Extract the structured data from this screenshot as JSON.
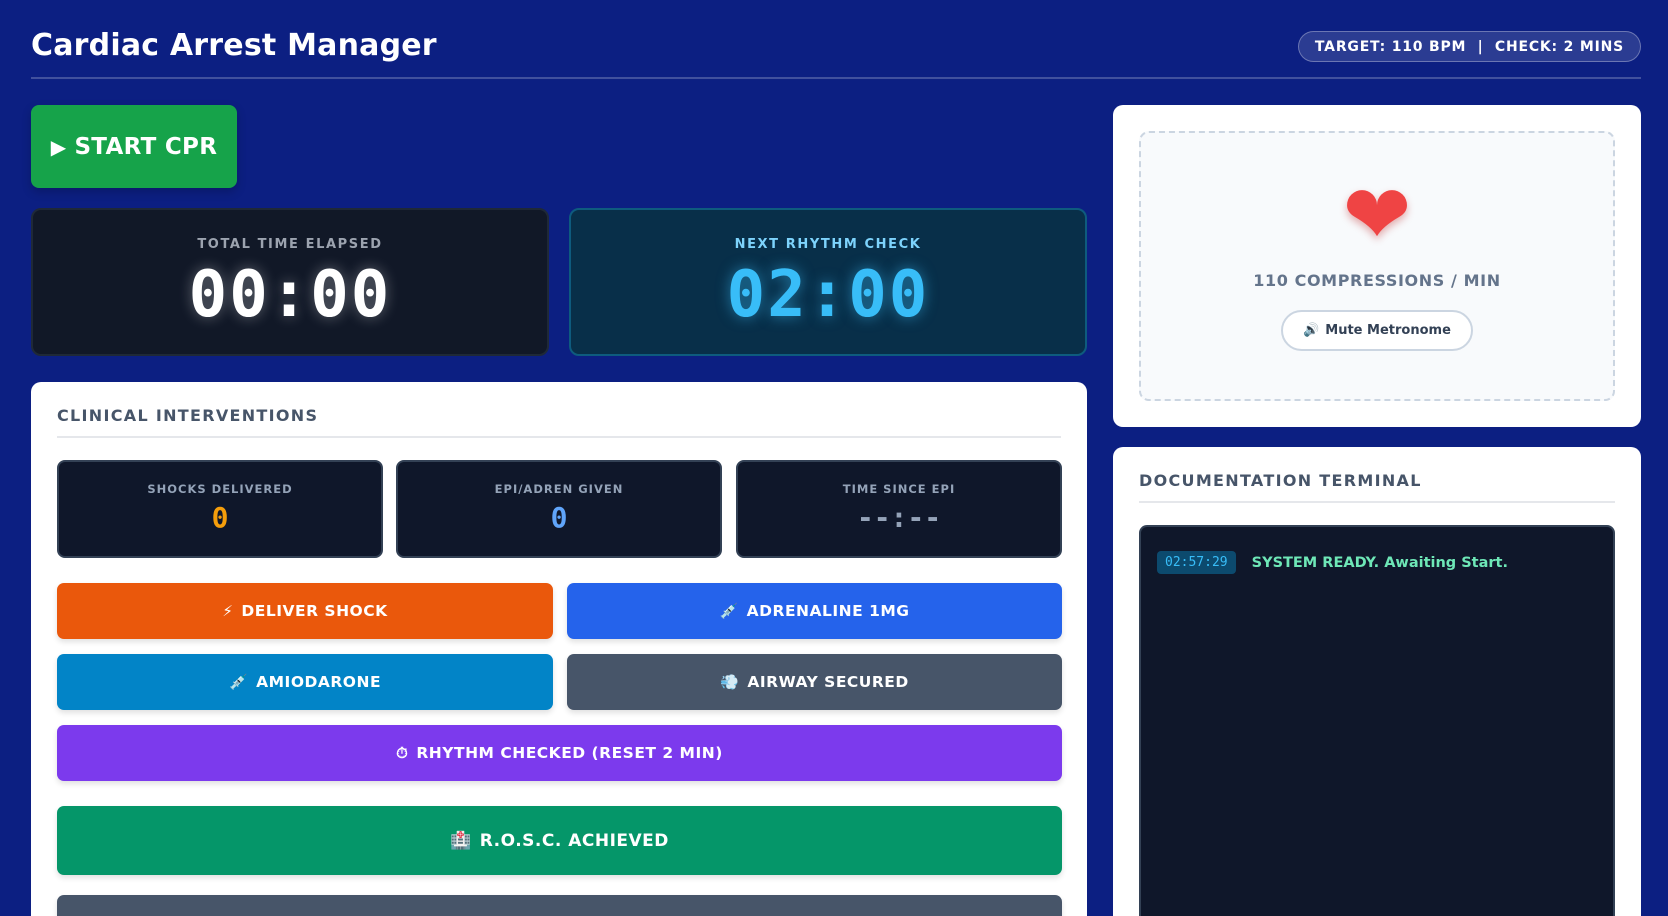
{
  "header": {
    "title": "Cardiac Arrest Manager",
    "target_pill": "TARGET: 110 BPM  |  CHECK: 2 MINS"
  },
  "start_button": {
    "icon": "play-icon",
    "glyph": "▶",
    "label": "START CPR"
  },
  "timers": {
    "total": {
      "label": "TOTAL TIME ELAPSED",
      "value": "00:00"
    },
    "next_check": {
      "label": "NEXT RHYTHM CHECK",
      "value": "02:00"
    }
  },
  "clinical": {
    "heading": "CLINICAL INTERVENTIONS",
    "stats": [
      {
        "label": "SHOCKS DELIVERED",
        "value": "0",
        "color": "#f59e0b"
      },
      {
        "label": "EPI/ADREN GIVEN",
        "value": "0",
        "color": "#60a5fa"
      },
      {
        "label": "TIME SINCE EPI",
        "value": "--:--",
        "color": "#94a3b8"
      }
    ],
    "actions": {
      "shock": {
        "glyph": "⚡",
        "label": "DELIVER SHOCK",
        "color": "#ea580c"
      },
      "adrenaline": {
        "glyph": "💉",
        "label": "ADRENALINE 1MG",
        "color": "#2563eb"
      },
      "amiodarone": {
        "glyph": "💉",
        "label": "AMIODARONE",
        "color": "#0284c7"
      },
      "airway": {
        "glyph": "💨",
        "label": "AIRWAY SECURED",
        "color": "#475569"
      },
      "rhythm": {
        "glyph": "⏱",
        "label": "RHYTHM CHECKED (RESET 2 MIN)",
        "color": "#7c3aed"
      },
      "rosc": {
        "glyph": "🏥",
        "label": "R.O.S.C. ACHIEVED",
        "color": "#059669"
      },
      "next_hidden": {
        "color": "#475569"
      }
    }
  },
  "metronome": {
    "icon": "heart-icon",
    "glyph": "❤",
    "rate_label": "110 COMPRESSIONS / MIN",
    "mute": {
      "glyph": "🔊",
      "label": "Mute Metronome"
    }
  },
  "documentation": {
    "heading": "DOCUMENTATION TERMINAL",
    "log": [
      {
        "time": "02:57:29",
        "message": "SYSTEM READY. Awaiting Start."
      }
    ]
  }
}
